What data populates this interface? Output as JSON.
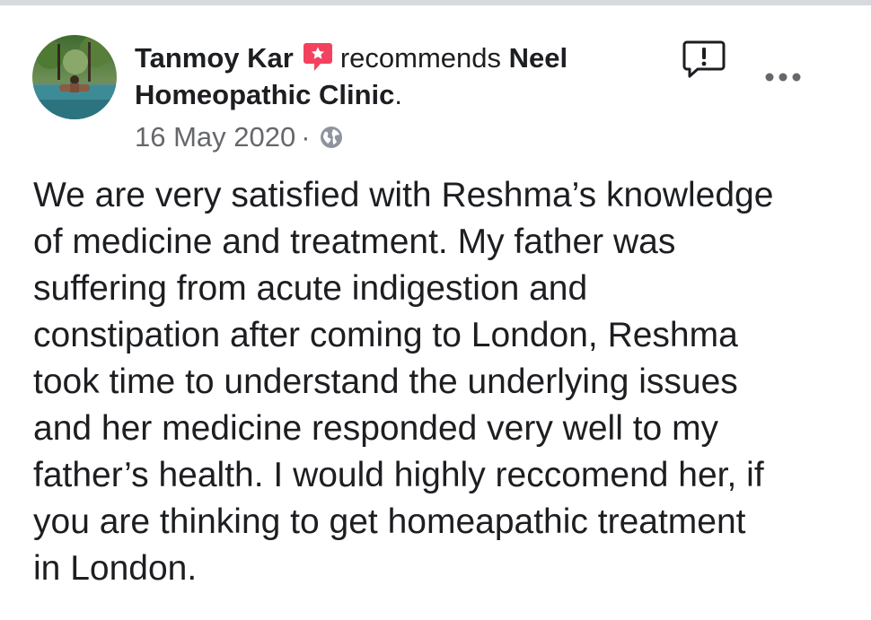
{
  "post": {
    "author": "Tanmoy Kar",
    "action": "recommends",
    "page_name_part1": "Neel",
    "page_name_part2": "Homeopathic Clinic",
    "page_name_suffix": ".",
    "date": "16 May 2020",
    "separator": "·",
    "privacy_icon": "globe-icon",
    "recommend_badge_icon": "recommendation-star-icon",
    "report_icon": "report-icon",
    "more_icon": "more-options-icon",
    "review_lines": [
      "We are very satisfied with Reshma’s knowledge",
      "of medicine and treatment. My father was",
      "suffering from acute indigestion and",
      "constipation after coming to London, Reshma",
      "took time to understand the underlying issues",
      "and her medicine responded very well to my",
      "father’s health. I would highly reccomend her, if",
      "you are thinking to get homeapathic treatment",
      "in London."
    ]
  },
  "colors": {
    "recommend_badge": "#f3425f",
    "secondary_text": "#65676b",
    "primary_text": "#1c1e21",
    "top_rule": "#d6d9dd"
  }
}
